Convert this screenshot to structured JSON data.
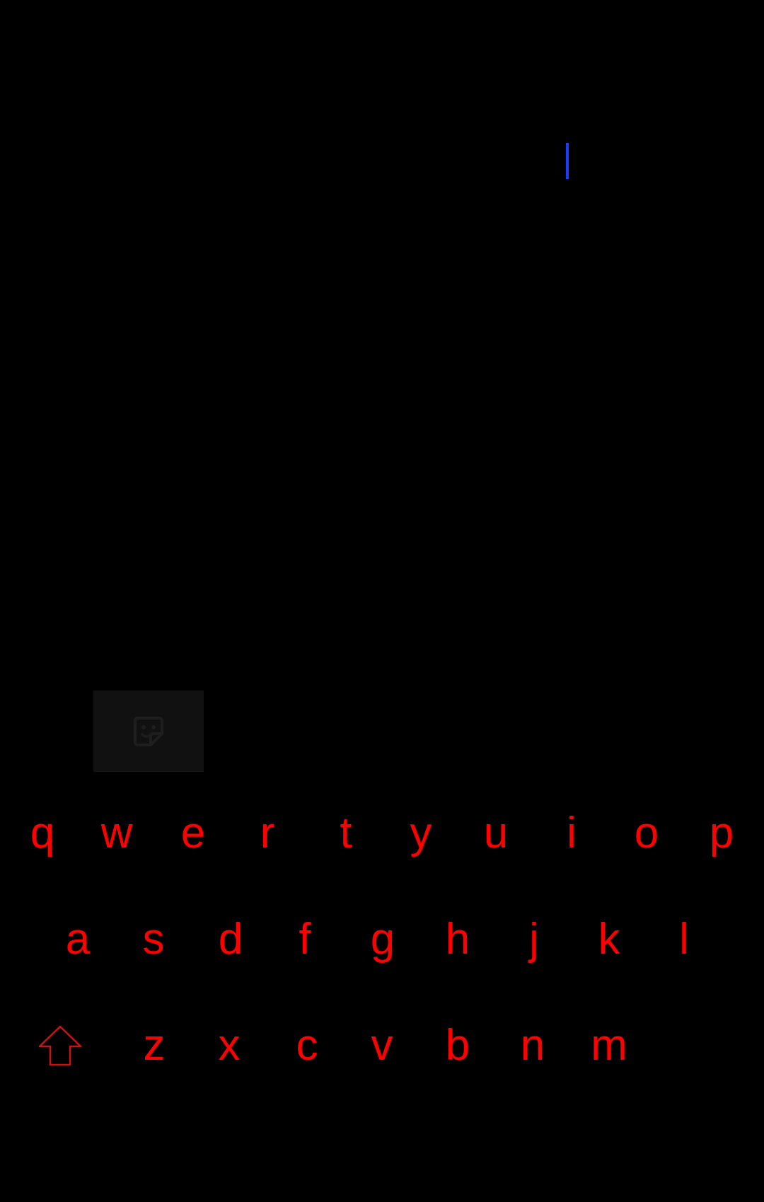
{
  "colors": {
    "background": "#000000",
    "cursor": "#1a3cff",
    "key_text": "#ff0000",
    "sticker_button_bg": "#111111",
    "sticker_icon": "#1e1e1e",
    "shift_outline": "#cc1111"
  },
  "toolbar": {
    "sticker_icon": "sticker-smile-icon"
  },
  "keyboard": {
    "rows": [
      [
        "q",
        "w",
        "e",
        "r",
        "t",
        "y",
        "u",
        "i",
        "o",
        "p"
      ],
      [
        "a",
        "s",
        "d",
        "f",
        "g",
        "h",
        "j",
        "k",
        "l"
      ],
      [
        "z",
        "x",
        "c",
        "v",
        "b",
        "n",
        "m"
      ]
    ],
    "shift_icon": "shift-arrow-icon"
  }
}
